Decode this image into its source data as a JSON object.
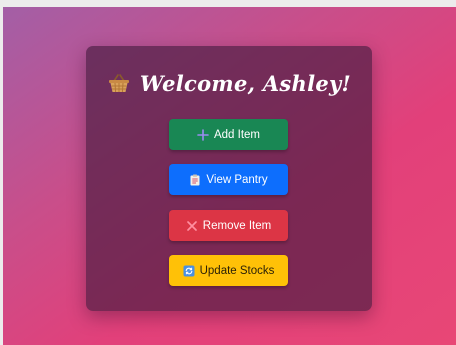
{
  "card": {
    "title": "Welcome, Ashley!",
    "title_icon": "basket-icon"
  },
  "buttons": [
    {
      "label": "Add Item",
      "icon": "plus-icon",
      "color": "#198754"
    },
    {
      "label": "View Pantry",
      "icon": "clipboard-icon",
      "color": "#0d6efd"
    },
    {
      "label": "Remove Item",
      "icon": "cross-icon",
      "color": "#dc3545"
    },
    {
      "label": "Update Stocks",
      "icon": "refresh-icon",
      "color": "#ffc107"
    }
  ],
  "colors": {
    "background_start": "#a35fa6",
    "background_end": "#e84776",
    "card": "#46203f"
  }
}
